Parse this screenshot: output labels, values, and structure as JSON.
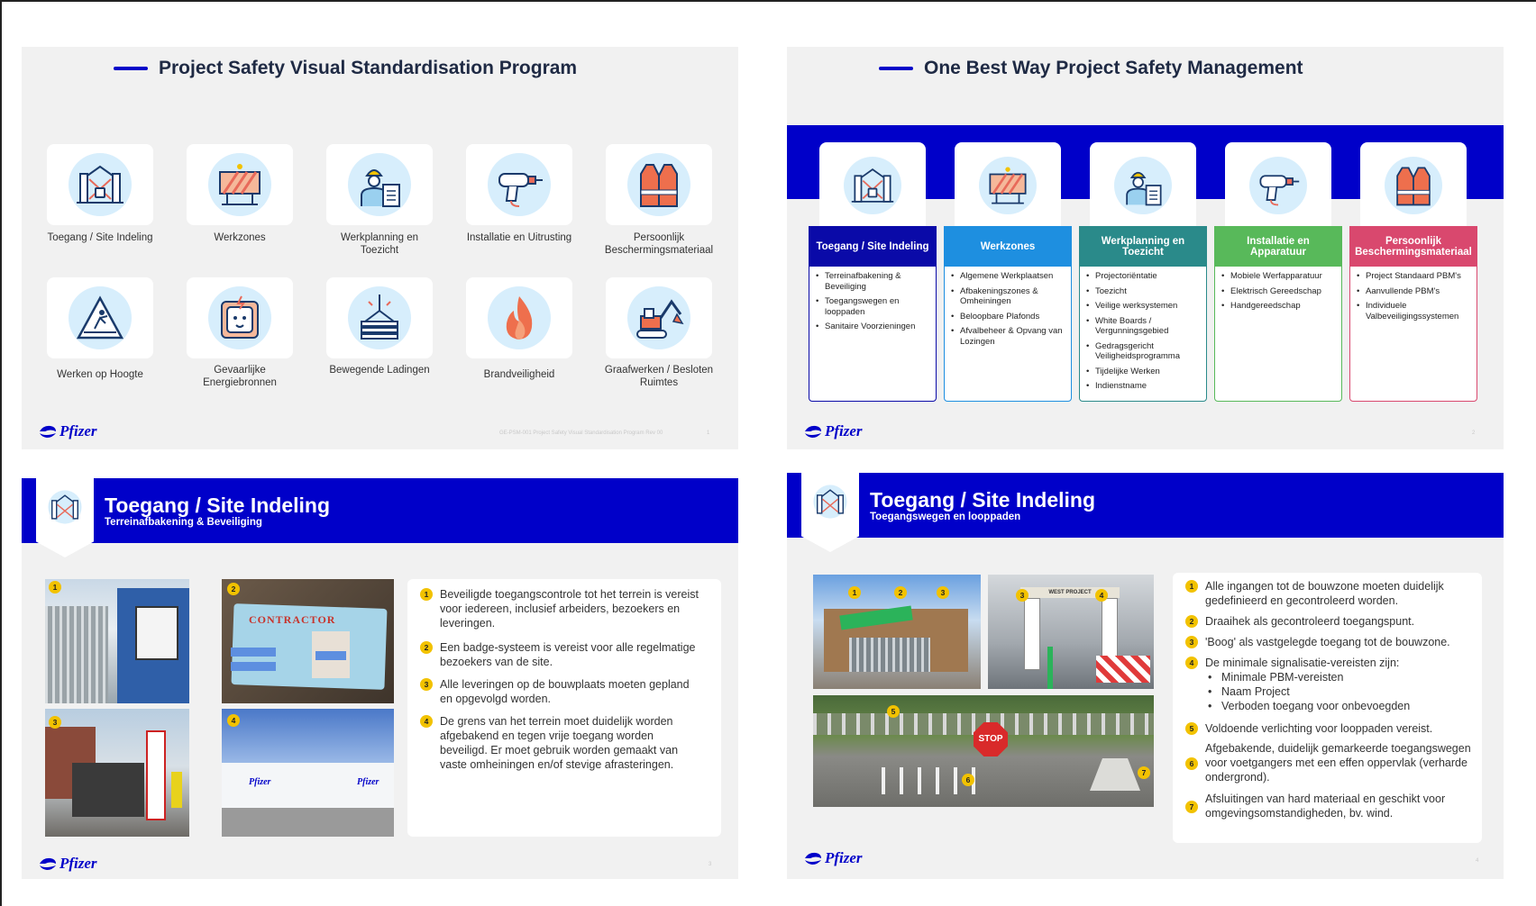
{
  "slide1": {
    "title": "Project Safety Visual Standardisation Program",
    "tiles": [
      {
        "label": "Toegang / Site Indeling",
        "icon": "gate-icon"
      },
      {
        "label": "Werkzones",
        "icon": "barrier-icon"
      },
      {
        "label": "Werkplanning en Toezicht",
        "icon": "worker-clipboard-icon"
      },
      {
        "label": "Installatie en Uitrusting",
        "icon": "drill-icon"
      },
      {
        "label": "Persoonlijk Beschermingsmateriaal",
        "icon": "safety-vest-icon"
      },
      {
        "label": "Werken op Hoogte",
        "icon": "fall-warning-icon"
      },
      {
        "label": "Gevaarlijke Energiebronnen",
        "icon": "electric-socket-icon"
      },
      {
        "label": "Bewegende Ladingen",
        "icon": "crane-load-icon"
      },
      {
        "label": "Brandveiligheid",
        "icon": "flame-icon"
      },
      {
        "label": "Graafwerken / Besloten Ruimtes",
        "icon": "excavator-icon"
      }
    ],
    "footer": "GE-PSM-001 Project Safety Visual Standardisation Program Rev 00",
    "page": "1",
    "logo": "Pfizer"
  },
  "slide2": {
    "title": "One Best Way Project Safety Management",
    "columns": [
      {
        "head": "Toegang / Site Indeling",
        "color": "#0a0aa8",
        "icon": "gate-icon",
        "items": [
          "Terreinafbakening & Beveiliging",
          "Toegangswegen en looppaden",
          "Sanitaire Voorzieningen"
        ]
      },
      {
        "head": "Werkzones",
        "color": "#1e8fe0",
        "icon": "barrier-icon",
        "items": [
          "Algemene Werkplaatsen",
          "Afbakeningszones & Omheiningen",
          "Beloopbare Plafonds",
          "Afvalbeheer & Opvang van Lozingen"
        ]
      },
      {
        "head": "Werkplanning en Toezicht",
        "color": "#2a8a8a",
        "icon": "worker-clipboard-icon",
        "items": [
          "Projectoriëntatie",
          "Toezicht",
          "Veilige werksystemen",
          "White Boards / Vergunningsgebied",
          "Gedragsgericht Veiligheidsprogramma",
          "Tijdelijke Werken",
          "Indienstname"
        ]
      },
      {
        "head": "Installatie en Apparatuur",
        "color": "#58b95a",
        "icon": "drill-icon",
        "items": [
          "Mobiele Werfapparatuur",
          "Elektrisch Gereedschap",
          "Handgereedschap"
        ]
      },
      {
        "head": "Persoonlijk Beschermingsmateriaal",
        "color": "#d9486e",
        "icon": "safety-vest-icon",
        "items": [
          "Project Standaard PBM's",
          "Aanvullende PBM's",
          "Individuele Valbeveiligingssystemen"
        ]
      }
    ],
    "page": "2",
    "logo": "Pfizer"
  },
  "slide3": {
    "title": "Toegang / Site Indeling",
    "subtitle": "Terreinafbakening & Beveiliging",
    "photo_pins": [
      "1",
      "2",
      "3",
      "4"
    ],
    "photo_badge_text": "CONTRACTOR",
    "points": [
      {
        "num": "1",
        "text": "Beveiligde toegangscontrole tot het terrein is vereist voor iedereen, inclusief arbeiders, bezoekers en leveringen."
      },
      {
        "num": "2",
        "text": "Een badge-systeem is vereist voor alle regelmatige bezoekers van de site."
      },
      {
        "num": "3",
        "text": "Alle leveringen op de bouwplaats moeten gepland en opgevolgd worden."
      },
      {
        "num": "4",
        "text": "De grens van het terrein moet duidelijk worden afgebakend en tegen vrije toegang worden beveiligd. Er moet gebruik worden gemaakt van vaste omheiningen en/of stevige afrasteringen."
      }
    ],
    "page": "3",
    "logo": "Pfizer"
  },
  "slide4": {
    "title": "Toegang / Site Indeling",
    "subtitle": "Toegangswegen en looppaden",
    "photo_sign_text": "WEST PROJECT",
    "photo_stop_text": "STOP",
    "photo_pins": [
      "1",
      "2",
      "3",
      "3",
      "4",
      "5",
      "6",
      "7"
    ],
    "points": [
      {
        "num": "1",
        "text": "Alle ingangen tot de bouwzone moeten duidelijk gedefinieerd en gecontroleerd worden."
      },
      {
        "num": "2",
        "text": "Draaihek als gecontroleerd toegangspunt."
      },
      {
        "num": "3",
        "text": "'Boog' als vastgelegde toegang tot de bouwzone."
      },
      {
        "num": "4",
        "text": "De minimale signalisatie-vereisten zijn:"
      },
      {
        "num": "5",
        "text": "Voldoende verlichting voor looppaden vereist."
      },
      {
        "num": "6",
        "text": "Afgebakende, duidelijk gemarkeerde toegangswegen voor voetgangers met een effen oppervlak (verharde ondergrond)."
      },
      {
        "num": "7",
        "text": "Afsluitingen van hard materiaal en geschikt voor omgevingsomstandigheden, bv. wind."
      }
    ],
    "sub_items": [
      "Minimale PBM-vereisten",
      "Naam Project",
      "Verboden toegang voor onbevoegden"
    ],
    "page": "4",
    "logo": "Pfizer"
  },
  "colors": {
    "brand_blue": "#0000c9",
    "pin_yellow": "#f2c200",
    "slide_bg": "#f1f1f1"
  }
}
